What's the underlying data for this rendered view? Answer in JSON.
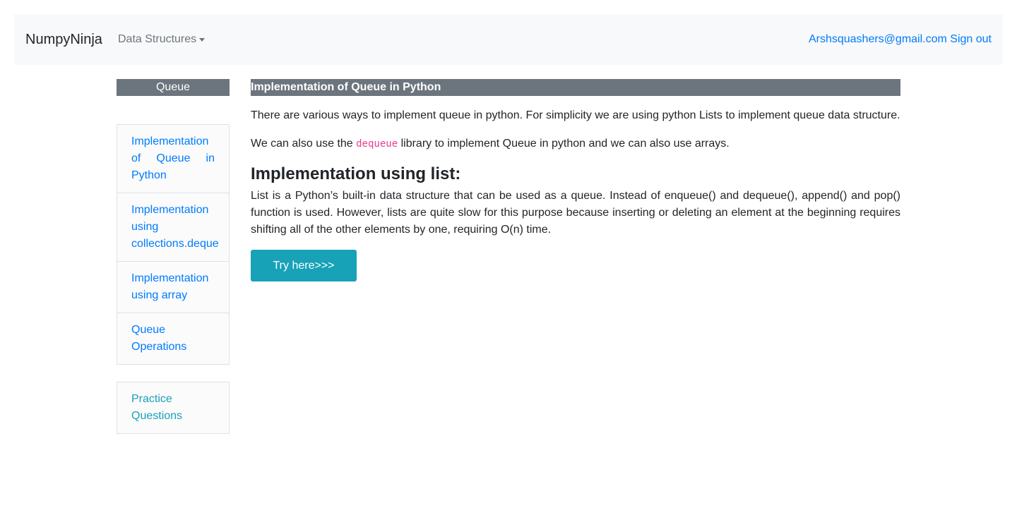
{
  "navbar": {
    "brand": "NumpyNinja",
    "dropdown_label": "Data Structures",
    "user_email": "Arshsquashers@gmail.com",
    "signout_label": "Sign out"
  },
  "sidebar": {
    "header": "Queue",
    "items": [
      {
        "label": "Implementation of Queue in Python"
      },
      {
        "label": "Implementation using collections.deque"
      },
      {
        "label": "Implementation using array"
      },
      {
        "label": "Queue Operations"
      }
    ],
    "practice_label": "Practice Questions"
  },
  "main": {
    "header": "Implementation of Queue in Python",
    "para1": "There are various ways to implement queue in python. For simplicity we are using python Lists to implement queue data structure.",
    "para2_before": "We can also use the ",
    "para2_code": "dequeue",
    "para2_after": " library to implement Queue in python and we can also use arrays.",
    "subheading": "Implementation using list:",
    "para3": "List is a Python’s built-in data structure that can be used as a queue. Instead of enqueue() and dequeue(), append() and pop() function is used. However, lists are quite slow for this purpose because inserting or deleting an element at the beginning requires shifting all of the other elements by one, requiring O(n) time.",
    "try_button": "Try here>>>"
  },
  "colors": {
    "navbar_bg": "#f8f9fa",
    "header_bg": "#6c757d",
    "link": "#007bff",
    "practice_link": "#17a2b8",
    "button_bg": "#17a2b8",
    "code": "#e83e8c"
  }
}
